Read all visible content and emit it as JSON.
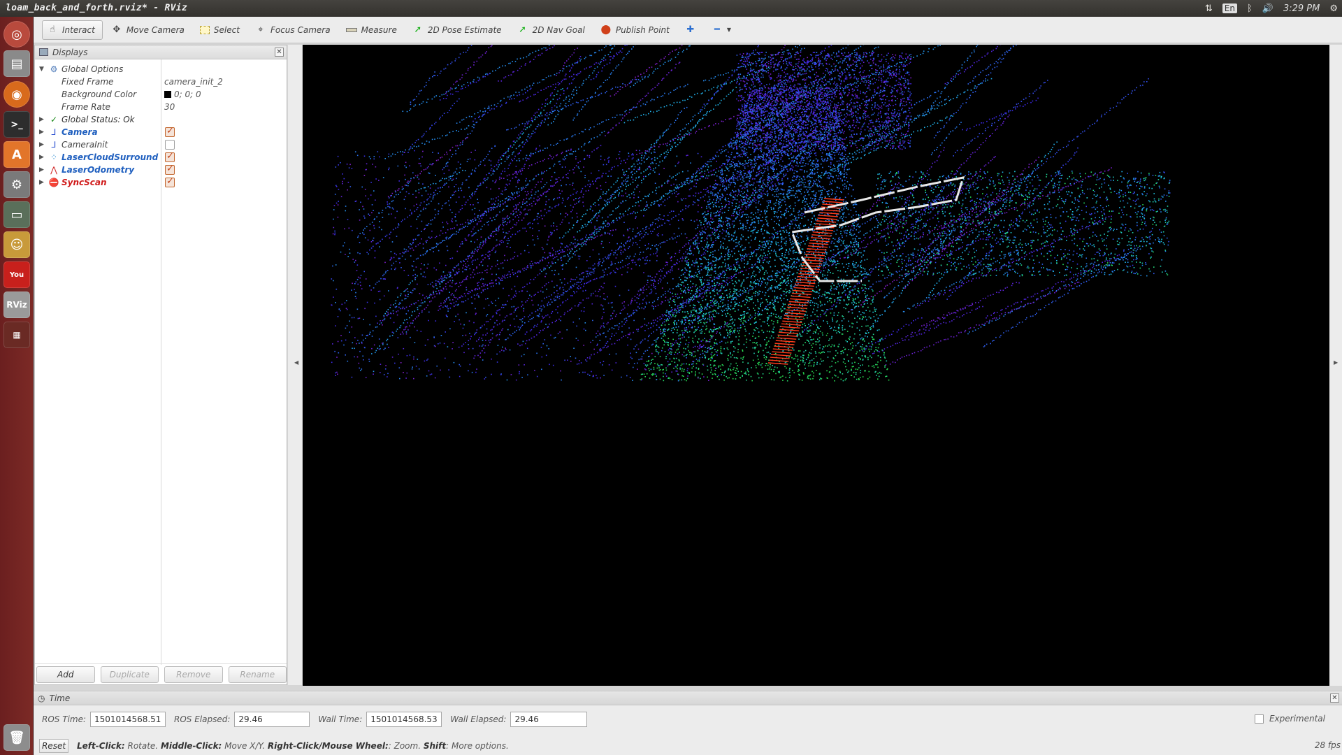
{
  "window": {
    "title": "loam_back_and_forth.rviz* - RViz"
  },
  "tray": {
    "lang": "En",
    "time": "3:29 PM"
  },
  "launcher": [
    "ubuntu-dash-icon",
    "files-icon",
    "firefox-icon",
    "terminal-icon",
    "software-center-icon",
    "settings-icon",
    "disk-icon",
    "gimp-icon",
    "youtube-icon",
    "rviz-icon",
    "workspace-icon",
    "trash-icon"
  ],
  "toolbar": {
    "tools": [
      {
        "label": "Interact",
        "icon": "hand-icon",
        "active": true
      },
      {
        "label": "Move Camera",
        "icon": "move-camera-icon"
      },
      {
        "label": "Select",
        "icon": "select-icon"
      },
      {
        "label": "Focus Camera",
        "icon": "focus-camera-icon"
      },
      {
        "label": "Measure",
        "icon": "ruler-icon"
      },
      {
        "label": "2D Pose Estimate",
        "icon": "green-arrow-icon"
      },
      {
        "label": "2D Nav Goal",
        "icon": "green-arrow-icon"
      },
      {
        "label": "Publish Point",
        "icon": "map-pin-icon"
      }
    ]
  },
  "displays": {
    "title": "Displays",
    "global_options": {
      "label": "Global Options",
      "fixed_frame_label": "Fixed Frame",
      "fixed_frame_value": "camera_init_2",
      "bg_label": "Background Color",
      "bg_value": "0; 0; 0",
      "frame_rate_label": "Frame Rate",
      "frame_rate_value": "30"
    },
    "global_status": "Global Status: Ok",
    "items": [
      {
        "label": "Camera",
        "checked": true,
        "color": "#1f5fbf"
      },
      {
        "label": "CameraInit",
        "checked": false,
        "color": "#444444"
      },
      {
        "label": "LaserCloudSurround",
        "checked": true,
        "color": "#1f5fbf"
      },
      {
        "label": "LaserOdometry",
        "checked": true,
        "color": "#1f5fbf"
      },
      {
        "label": "SyncScan",
        "checked": true,
        "color": "#d01a1a"
      }
    ],
    "buttons": {
      "add": "Add",
      "duplicate": "Duplicate",
      "remove": "Remove",
      "rename": "Rename"
    }
  },
  "time": {
    "title": "Time",
    "ros_time_label": "ROS Time:",
    "ros_time": "1501014568.51",
    "ros_elapsed_label": "ROS Elapsed:",
    "ros_elapsed": "29.46",
    "wall_time_label": "Wall Time:",
    "wall_time": "1501014568.53",
    "wall_elapsed_label": "Wall Elapsed:",
    "wall_elapsed": "29.46",
    "experimental": "Experimental"
  },
  "status": {
    "reset": "Reset",
    "left_click": "Left-Click:",
    "left_click_desc": "Rotate.",
    "middle_click": "Middle-Click:",
    "middle_click_desc": "Move X/Y.",
    "right_click": "Right-Click/Mouse Wheel:",
    "right_click_desc": ": Zoom.",
    "shift": "Shift",
    "shift_desc": ": More options.",
    "fps": "28 fps"
  }
}
